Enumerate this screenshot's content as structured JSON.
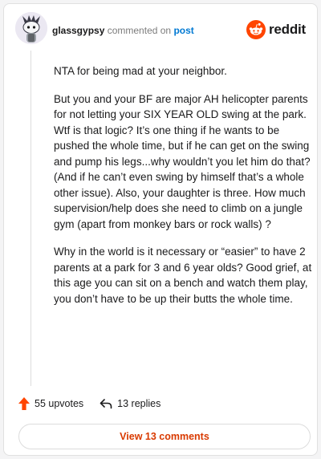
{
  "comment": {
    "username": "glassgypsy",
    "verb": "commented on",
    "post_link": "post",
    "paragraphs": [
      "NTA for being mad at your neighbor.",
      "But you and your BF are major AH helicopter parents for not letting your SIX YEAR OLD swing at the park. Wtf is that logic? It’s one thing if he wants to be pushed the whole time, but if he can get on the swing and pump his legs...why wouldn’t you let him do that? (And if he can’t even swing by himself that’s a whole other issue). Also, your daughter is three. How much supervision/help does she need to climb on a jungle gym (apart from monkey bars or rock walls) ?",
      "Why in the world is it necessary or “easier” to have 2 parents at a park for 3 and 6 year olds? Good grief, at this age you can sit on a bench and watch them play, you don’t have to be up their butts the whole time."
    ]
  },
  "logo": {
    "text": "reddit",
    "icon": "reddit-alien-icon"
  },
  "actions": {
    "upvotes": "55 upvotes",
    "replies": "13 replies"
  },
  "view_comments_button": "View 13 comments",
  "colors": {
    "upvote": "#ff4500",
    "link": "#0079d3",
    "button_text": "#d93a00",
    "background": "#ffffff"
  }
}
